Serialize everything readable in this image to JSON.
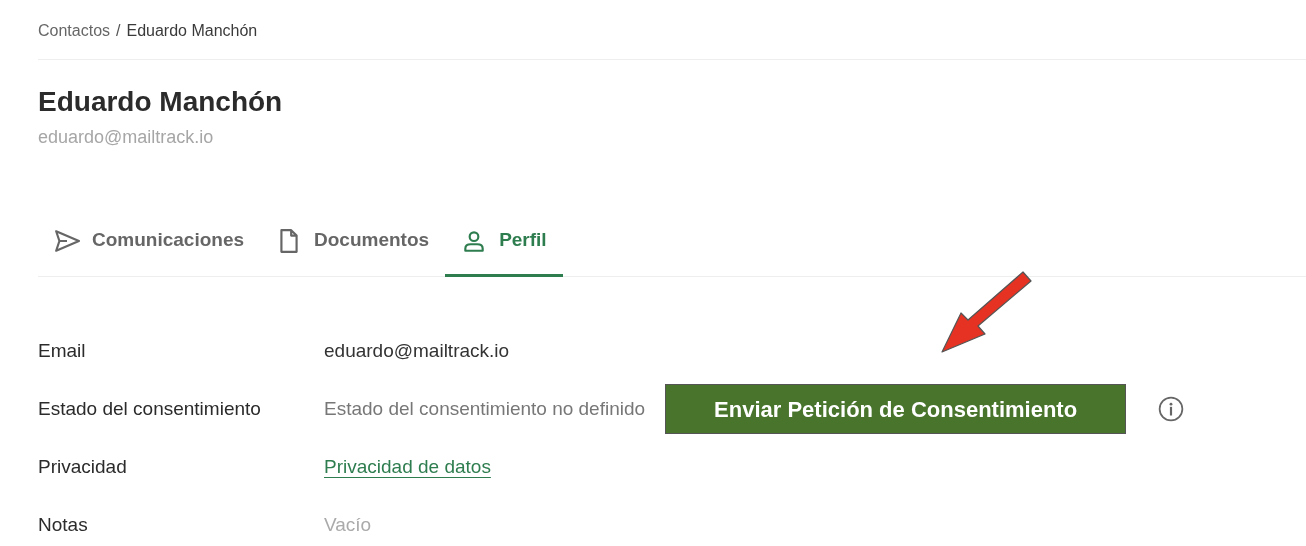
{
  "breadcrumb": [
    {
      "label": "Contactos",
      "current": false
    },
    {
      "label": "Eduardo Manchón",
      "current": true
    }
  ],
  "breadcrumb_separator": "/",
  "contact": {
    "name": "Eduardo Manchón",
    "email": "eduardo@mailtrack.io"
  },
  "tabs": [
    {
      "label": "Comunicaciones",
      "kind": "send",
      "selected": false
    },
    {
      "label": "Documentos",
      "kind": "document",
      "selected": false
    },
    {
      "label": "Perfil",
      "kind": "person",
      "selected": true
    }
  ],
  "fields": [
    {
      "label": "Email",
      "value": "eduardo@mailtrack.io",
      "kind": "text"
    },
    {
      "label": "Estado del consentimiento",
      "value": "Estado del consentimiento no definido",
      "kind": "muted",
      "action": "Enviar Petición de Consentimiento",
      "info": true
    },
    {
      "label": "Privacidad",
      "value": "Privacidad de datos",
      "kind": "link"
    },
    {
      "label": "Notas",
      "value": "Vacío",
      "kind": "empty"
    }
  ],
  "annotation": {
    "kind": "arrow"
  }
}
